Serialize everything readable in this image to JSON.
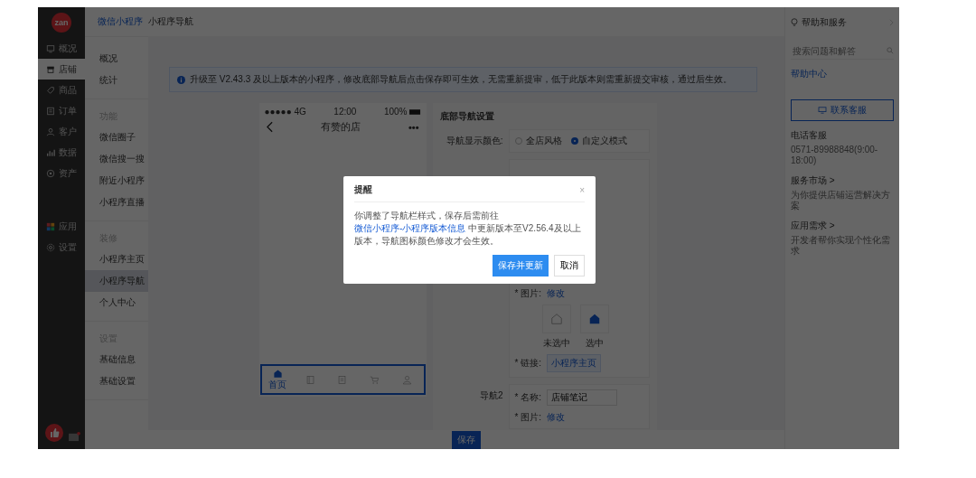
{
  "sidebar": {
    "logo": "zan",
    "groups": [
      {
        "items": [
          {
            "label": "概况",
            "selected": false
          },
          {
            "label": "店铺",
            "selected": true
          },
          {
            "label": "商品",
            "selected": false
          },
          {
            "label": "订单",
            "selected": false
          },
          {
            "label": "客户",
            "selected": false
          },
          {
            "label": "数据",
            "selected": false
          },
          {
            "label": "资产",
            "selected": false
          }
        ]
      },
      {
        "items": [
          {
            "label": "应用",
            "selected": false
          },
          {
            "label": "设置",
            "selected": false
          }
        ]
      }
    ]
  },
  "breadcrumb": {
    "link": "微信小程序",
    "current": "小程序导航"
  },
  "subnav": {
    "groups": [
      {
        "items": [
          {
            "label": "概况",
            "selected": false
          },
          {
            "label": "统计",
            "selected": false
          }
        ]
      },
      {
        "title": "功能",
        "items": [
          {
            "label": "微信圈子",
            "selected": false
          },
          {
            "label": "微信搜一搜",
            "selected": false
          },
          {
            "label": "附近小程序",
            "selected": false
          },
          {
            "label": "小程序直播",
            "selected": false
          }
        ]
      },
      {
        "title": "装修",
        "items": [
          {
            "label": "小程序主页",
            "selected": false
          },
          {
            "label": "小程序导航",
            "selected": true
          },
          {
            "label": "个人中心",
            "selected": false
          }
        ]
      },
      {
        "title": "设置",
        "items": [
          {
            "label": "基础信息",
            "selected": false
          },
          {
            "label": "基础设置",
            "selected": false
          }
        ]
      }
    ]
  },
  "notice": "升级至 V2.43.3 及以上版本的小程序，修改底部导航后点击保存即可生效，无需重新提审，低于此版本则需重新提交审核，通过后生效。",
  "phone": {
    "signal": "●●●●● 4G",
    "time": "12:00",
    "battery": "100%",
    "title": "有赞的店",
    "more": "•••",
    "tabs": [
      {
        "label": "首页",
        "selected": true
      },
      {
        "selected": false
      },
      {
        "selected": false
      },
      {
        "selected": false
      },
      {
        "selected": false
      }
    ]
  },
  "settings": {
    "title": "底部导航设置",
    "color_label": "导航显示颜色:",
    "color_options": [
      {
        "label": "全店风格",
        "selected": false
      },
      {
        "label": "自定义模式",
        "selected": true
      }
    ],
    "nav1": {
      "image_label": "* 图片:",
      "image_action": "修改",
      "tiles": [
        {
          "caption": "未选中",
          "selected": false
        },
        {
          "caption": "选中",
          "selected": true
        }
      ],
      "link_label": "* 链接:",
      "link_value": "小程序主页"
    },
    "nav2": {
      "title": "导航2",
      "name_label": "* 名称:",
      "name_value": "店铺笔记",
      "image_label": "* 图片:",
      "image_action": "修改"
    },
    "save": "保存"
  },
  "help": {
    "title": "帮助和服务",
    "search_placeholder": "搜索问题和解答",
    "center_link": "帮助中心",
    "contact": "联系客服",
    "sections": [
      {
        "title": "电话客服",
        "text": "0571-89988848(9:00-18:00)"
      },
      {
        "title": "服务市场 >",
        "text": "为你提供店铺运营解决方案"
      },
      {
        "title": "应用需求 >",
        "text": "开发者帮你实现个性化需求"
      }
    ]
  },
  "dialog": {
    "title": "提醒",
    "close": "×",
    "text_before": "你调整了导航栏样式，保存后需前往 ",
    "link": "微信小程序-小程序版本信息",
    "text_after": " 中更新版本至V2.56.4及以上版本，导航图标颜色修改才会生效。",
    "primary": "保存并更新",
    "secondary": "取消"
  }
}
